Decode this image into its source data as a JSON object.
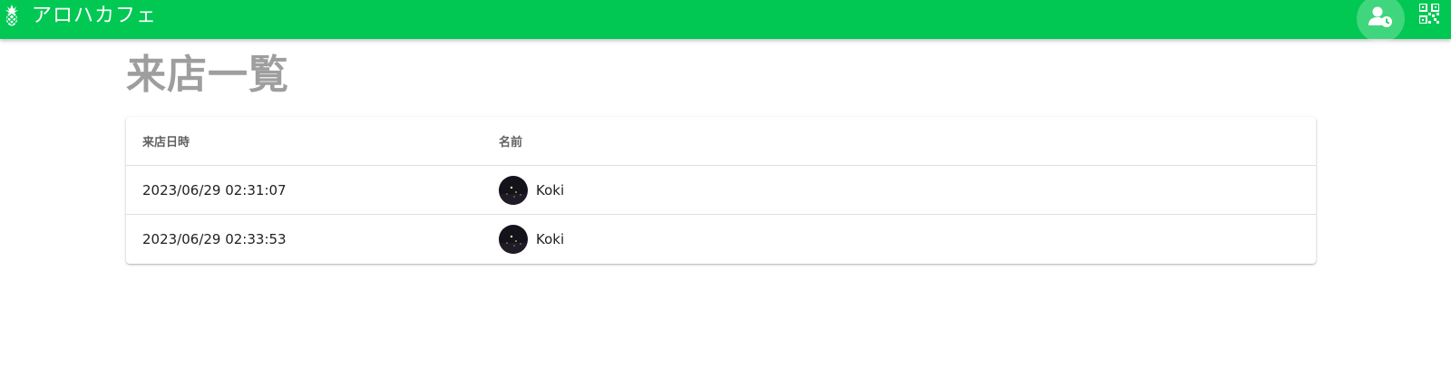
{
  "app": {
    "title": "アロハカフェ",
    "logo_icon": "pineapple-icon",
    "brand_color": "#00c853"
  },
  "toolbar": {
    "history_icon": "user-clock-icon",
    "qr_icon": "qr-code-icon"
  },
  "page": {
    "title": "来店一覧"
  },
  "table": {
    "columns": [
      "来店日時",
      "名前"
    ],
    "rows": [
      {
        "datetime": "2023/06/29 02:31:07",
        "name": "Koki",
        "avatar_icon": "avatar-image"
      },
      {
        "datetime": "2023/06/29 02:33:53",
        "name": "Koki",
        "avatar_icon": "avatar-image"
      }
    ]
  }
}
